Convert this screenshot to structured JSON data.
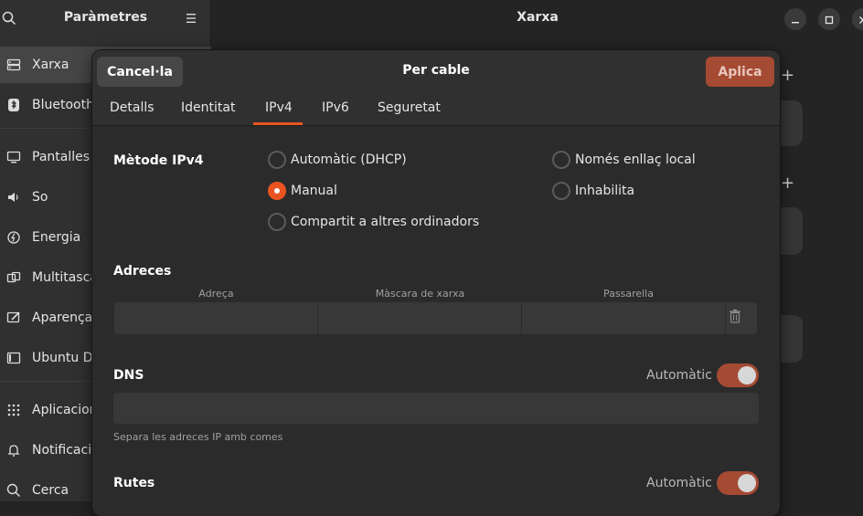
{
  "sidebar": {
    "title": "Paràmetres",
    "items": [
      {
        "label": "Xarxa",
        "icon": "network-wired-icon"
      },
      {
        "label": "Bluetooth",
        "icon": "bluetooth-icon"
      },
      {
        "label": "Pantalles",
        "icon": "display-icon"
      },
      {
        "label": "So",
        "icon": "speaker-icon"
      },
      {
        "label": "Energia",
        "icon": "power-icon"
      },
      {
        "label": "Multitasca",
        "icon": "multitasking-icon"
      },
      {
        "label": "Aparença",
        "icon": "appearance-icon"
      },
      {
        "label": "Ubuntu Desktop",
        "icon": "ubuntu-desktop-icon"
      },
      {
        "label": "Aplicacions",
        "icon": "apps-grid-icon"
      },
      {
        "label": "Notificacions",
        "icon": "bell-icon"
      },
      {
        "label": "Cerca",
        "icon": "search-icon"
      }
    ]
  },
  "main": {
    "title": "Xarxa"
  },
  "dialog": {
    "title": "Per cable",
    "cancel_label": "Cancel·la",
    "apply_label": "Aplica",
    "tabs": [
      {
        "label": "Detalls"
      },
      {
        "label": "Identitat"
      },
      {
        "label": "IPv4",
        "active": true
      },
      {
        "label": "IPv6"
      },
      {
        "label": "Seguretat"
      }
    ],
    "ipv4_method": {
      "label": "Mètode IPv4",
      "options": [
        {
          "label": "Automàtic (DHCP)",
          "selected": false
        },
        {
          "label": "Només enllaç local",
          "selected": false
        },
        {
          "label": "Manual",
          "selected": true
        },
        {
          "label": "Inhabilita",
          "selected": false
        },
        {
          "label": "Compartit a altres ordinadors",
          "selected": false
        }
      ]
    },
    "addresses": {
      "label": "Adreces",
      "columns": [
        "Adreça",
        "Màscara de xarxa",
        "Passarella"
      ],
      "row": [
        "",
        "",
        ""
      ]
    },
    "dns": {
      "label": "DNS",
      "auto_label": "Automàtic",
      "auto_on": true,
      "value": "",
      "hint": "Separa les adreces IP amb comes"
    },
    "routes": {
      "label": "Rutes",
      "auto_label": "Automàtic",
      "auto_on": true
    }
  },
  "colors": {
    "accent": "#e95420",
    "apply_bg": "#a54a33",
    "toggle_on": "#a54a33"
  }
}
